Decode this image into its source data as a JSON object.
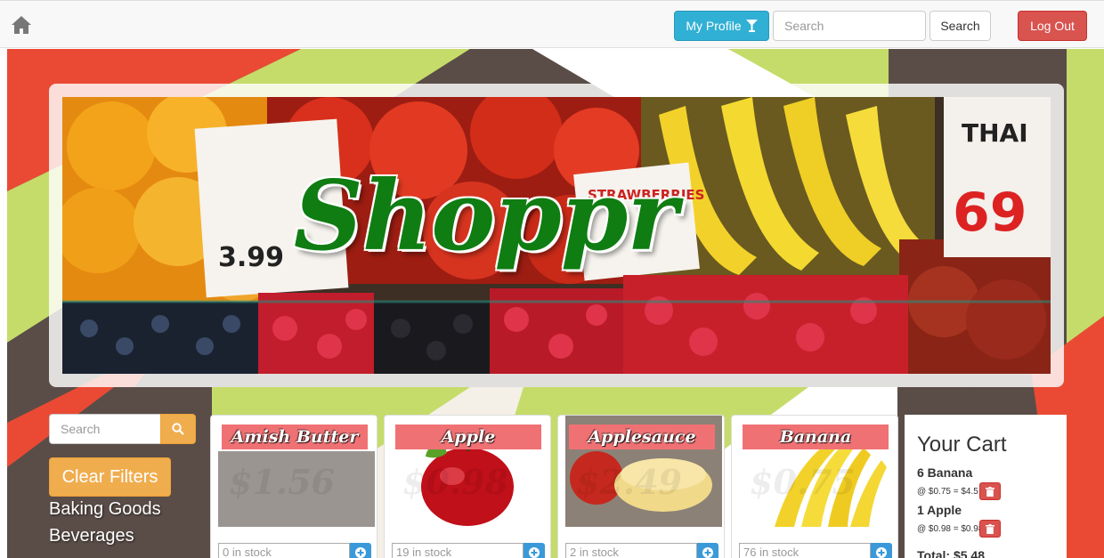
{
  "nav": {
    "home_icon": "home-icon",
    "profile_label": "My Profile",
    "search_placeholder": "Search",
    "search_button": "Search",
    "logout_label": "Log Out"
  },
  "hero": {
    "title": "Shoppr"
  },
  "sidebar": {
    "search_placeholder": "Search",
    "clear_filters": "Clear Filters",
    "categories": [
      "Baking Goods",
      "Beverages"
    ]
  },
  "products": [
    {
      "name": "Amish Butter",
      "price": "$1.56",
      "stock": "0 in stock"
    },
    {
      "name": "Apple",
      "price": "$0.98",
      "stock": "19 in stock"
    },
    {
      "name": "Applesauce",
      "price": "$2.49",
      "stock": "2 in stock"
    },
    {
      "name": "Banana",
      "price": "$0.75",
      "stock": "76 in stock"
    }
  ],
  "cart": {
    "title": "Your Cart",
    "items": [
      {
        "label": "6 Banana",
        "price": "@ $0.75 = $4.5"
      },
      {
        "label": "1 Apple",
        "price": "@ $0.98 = $0.98"
      }
    ],
    "total": "Total: $5.48"
  },
  "colors": {
    "info": "#31b0d5",
    "danger": "#d9534f",
    "warning": "#f0ad4e",
    "brand_green": "#0f7d12",
    "label_pink": "#f07174"
  }
}
